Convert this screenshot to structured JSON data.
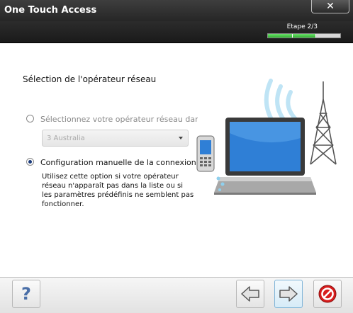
{
  "window": {
    "title": "One Touch Access",
    "close_label": "✕"
  },
  "wizard": {
    "step_label": "Etape 2/3",
    "progress": 0.6667,
    "progress_color": "#3cc23c"
  },
  "main": {
    "section_title": "Sélection de l'opérateur réseau",
    "option_list": {
      "label": "Sélectionnez votre opérateur réseau dans la",
      "selected": false,
      "select_value": "3 Australia"
    },
    "option_manual": {
      "label": "Configuration manuelle de la connexion",
      "selected": true,
      "description": "Utilisez cette option si votre opérateur réseau n'apparaît pas dans la liste ou si les paramètres prédéfinis ne semblent pas fonctionner."
    }
  },
  "footer": {
    "help_label": "?",
    "icons": {
      "back": "arrow-left-icon",
      "next": "arrow-right-icon",
      "cancel": "stop-icon"
    }
  }
}
